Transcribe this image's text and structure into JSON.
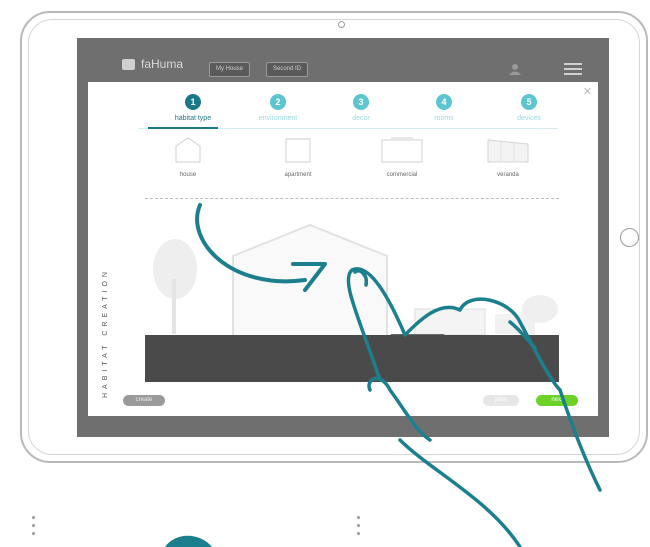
{
  "header": {
    "app_name": "faHuma",
    "btn_my_house": "My House",
    "btn_second": "Second ID"
  },
  "steps": [
    {
      "num": "1",
      "label": "habitat type",
      "active": true
    },
    {
      "num": "2",
      "label": "environment",
      "active": false
    },
    {
      "num": "3",
      "label": "decor",
      "active": false
    },
    {
      "num": "4",
      "label": "rooms",
      "active": false
    },
    {
      "num": "5",
      "label": "devices",
      "active": false
    }
  ],
  "habitat_types": [
    {
      "label": "house"
    },
    {
      "label": "apartment"
    },
    {
      "label": "commercial"
    },
    {
      "label": "veranda"
    }
  ],
  "side_label": "HABITAT CREATION",
  "footer": {
    "create_label": "create",
    "prev_label": "prev",
    "next_label": "next"
  },
  "colors": {
    "accent": "#1b7a8a",
    "step_inactive": "#5cc5cf",
    "next_green": "#6cd22a",
    "gesture": "#1c7f8e"
  }
}
